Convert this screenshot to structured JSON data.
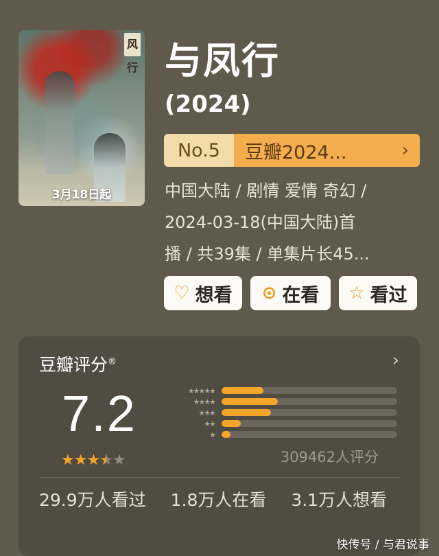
{
  "poster": {
    "stamp_text": "风行",
    "release_badge": "3月18日起"
  },
  "title": "与凤行",
  "year": "(2024)",
  "rank": {
    "number": "No.5",
    "list_name": "豆瓣2024...",
    "chevron": "›"
  },
  "meta_lines": [
    "中国大陆 / 剧情 爱情 奇幻 /",
    "2024-03-18(中国大陆)首",
    "播 / 共39集 / 单集片长45..."
  ],
  "actions": [
    {
      "icon": "heart-plus-icon",
      "glyph": "♡",
      "label": "想看"
    },
    {
      "icon": "target-icon",
      "glyph": "⊙",
      "label": "在看"
    },
    {
      "icon": "star-outline-icon",
      "glyph": "☆",
      "label": "看过"
    }
  ],
  "rating": {
    "section_title": "豆瓣评分",
    "registered_mark": "®",
    "chevron": "›",
    "score": "7.2",
    "stars_value": 3.5,
    "stars_max": 5,
    "distribution": [
      {
        "label": "★★★★★",
        "fraction": 0.24
      },
      {
        "label": "★★★★",
        "fraction": 0.32
      },
      {
        "label": "★★★",
        "fraction": 0.28
      },
      {
        "label": "★★",
        "fraction": 0.11
      },
      {
        "label": "★",
        "fraction": 0.05
      }
    ],
    "votes": "309462人评分",
    "summary": "29.9万人看过 1.8万人在看 3.1万人想看"
  },
  "watermark": "快传号 / 与君说事",
  "colors": {
    "background": "#5f5a4c",
    "panel": "#504c41",
    "accent": "#f4a62a",
    "rank_badge": "#f4ae4d"
  }
}
